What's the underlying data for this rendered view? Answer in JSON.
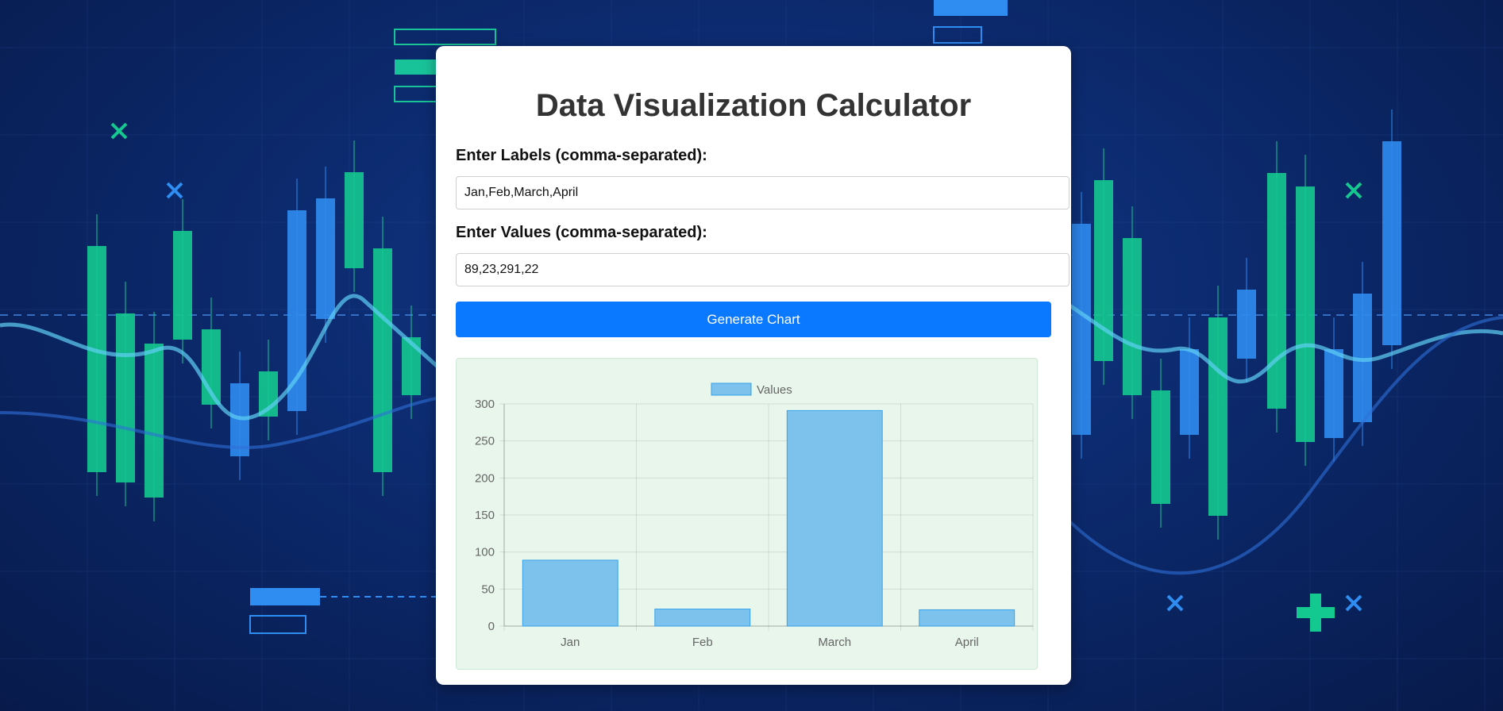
{
  "page": {
    "title": "Data Visualization Calculator"
  },
  "form": {
    "labels_label": "Enter Labels (comma-separated):",
    "labels_value": "Jan,Feb,March,April",
    "values_label": "Enter Values (comma-separated):",
    "values_value": "89,23,291,22",
    "generate_button": "Generate Chart"
  },
  "colors": {
    "button": "#0a78ff",
    "bar_fill": "#7cc2ec",
    "bar_stroke": "#36a2eb",
    "chart_bg": "#e8f6ec"
  },
  "chart_data": {
    "type": "bar",
    "categories": [
      "Jan",
      "Feb",
      "March",
      "April"
    ],
    "series": [
      {
        "name": "Values",
        "values": [
          89,
          23,
          291,
          22
        ]
      }
    ],
    "title": "",
    "xlabel": "",
    "ylabel": "",
    "ylim": [
      0,
      300
    ],
    "yticks": [
      0,
      50,
      100,
      150,
      200,
      250,
      300
    ],
    "grid": true,
    "legend": "top-center"
  }
}
